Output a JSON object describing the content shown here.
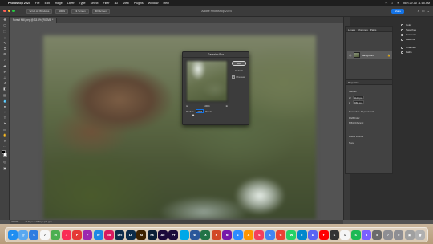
{
  "menubar": {
    "app_name": "Photoshop 2024",
    "items": [
      "File",
      "Edit",
      "Image",
      "Layer",
      "Type",
      "Select",
      "Filter",
      "3D",
      "View",
      "Plugins",
      "Window",
      "Help"
    ],
    "datetime": "Mon 29 Jul 11:15 AM"
  },
  "titlebar": {
    "title": "Adobe Photoshop 2024",
    "options": [
      "Scrub All Windows",
      "100%",
      "Fit Screen",
      "Fill Screen"
    ],
    "share_label": "Share"
  },
  "document": {
    "tab_label": "Forest Mill.jpeg @ 33.3% (RGB/8) *"
  },
  "status": {
    "zoom": "33.33%",
    "info": "3120 px x 2080 px (72 ppi)"
  },
  "dialog": {
    "title": "Gaussian Blur",
    "ok_label": "OK",
    "reset_label": "Default",
    "preview_label": "Preview",
    "zoom_level": "100%",
    "radius_label": "Radius:",
    "radius_value": "14.9",
    "radius_unit": "Pixels",
    "radius_fraction": 0.18
  },
  "layers_panel": {
    "tabs": [
      "Layers",
      "Channels",
      "Paths"
    ],
    "layer_name": "Background"
  },
  "properties_panel": {
    "title": "Properties",
    "section": "Canvas",
    "width": "3120 px",
    "height": "2080 px",
    "resolution": "Resolution: 72 pixels/inch",
    "mode": "RGB Color",
    "depth": "8 Bits/Channel",
    "rulers": "Rulers & Grids",
    "fill": "None"
  },
  "right_list": [
    "Color",
    "Swatches",
    "Gradients",
    "Patterns",
    "Channels",
    "Paths"
  ],
  "tools": [
    "move",
    "artboard",
    "marquee",
    "lasso",
    "quick-select",
    "crop",
    "frame",
    "eyedropper",
    "heal",
    "brush",
    "stamp",
    "history",
    "eraser",
    "gradient",
    "blur",
    "dodge",
    "pen",
    "type",
    "path-select",
    "rectangle",
    "hand",
    "zoom",
    "more"
  ],
  "dock": [
    {
      "label": "F",
      "color": "#1f8ef1"
    },
    {
      "label": "@",
      "color": "#5aa8f0"
    },
    {
      "label": "S",
      "color": "#2f7de1"
    },
    {
      "label": "7",
      "color": "#f6f6f6"
    },
    {
      "label": "M",
      "color": "#4caf50"
    },
    {
      "label": "♪",
      "color": "#fa2d55"
    },
    {
      "label": "P",
      "color": "#e53935"
    },
    {
      "label": "F",
      "color": "#9c27b0"
    },
    {
      "label": "W",
      "color": "#1e88e5"
    },
    {
      "label": "Id",
      "color": "#d81b60"
    },
    {
      "label": "Lrc",
      "color": "#0c2c4a"
    },
    {
      "label": "Lr",
      "color": "#0c2c4a"
    },
    {
      "label": "Ai",
      "color": "#3d2200"
    },
    {
      "label": "Ps",
      "color": "#0a2036"
    },
    {
      "label": "Ae",
      "color": "#1b0a3a"
    },
    {
      "label": "Pr",
      "color": "#1b0a3a"
    },
    {
      "label": "T",
      "color": "#00a8e8"
    },
    {
      "label": "W",
      "color": "#2b579a"
    },
    {
      "label": "X",
      "color": "#217346"
    },
    {
      "label": "P",
      "color": "#d24726"
    },
    {
      "label": "N",
      "color": "#7719aa"
    },
    {
      "label": "Z",
      "color": "#2d8cff"
    },
    {
      "label": "A",
      "color": "#ff9500"
    },
    {
      "label": "S",
      "color": "#f43f5e"
    },
    {
      "label": "C",
      "color": "#4285f4"
    },
    {
      "label": "G",
      "color": "#ea4335"
    },
    {
      "label": "W",
      "color": "#25d366"
    },
    {
      "label": "T",
      "color": "#0088cc"
    },
    {
      "label": "D",
      "color": "#5865f2"
    },
    {
      "label": "Y",
      "color": "#ff0000"
    },
    {
      "label": "K",
      "color": "#333333"
    },
    {
      "label": "L",
      "color": "#f5f5f5"
    },
    {
      "label": "S",
      "color": "#1db954"
    },
    {
      "label": "B",
      "color": "#7b61ff"
    },
    {
      "label": "E",
      "color": "#6b6b6b"
    },
    {
      "label": "?",
      "color": "#8e8e93"
    },
    {
      "label": "⚙",
      "color": "#8e8e93"
    },
    {
      "label": "▣",
      "color": "#a0a0a0"
    },
    {
      "label": "🗑",
      "color": "#b0b0b0"
    }
  ]
}
